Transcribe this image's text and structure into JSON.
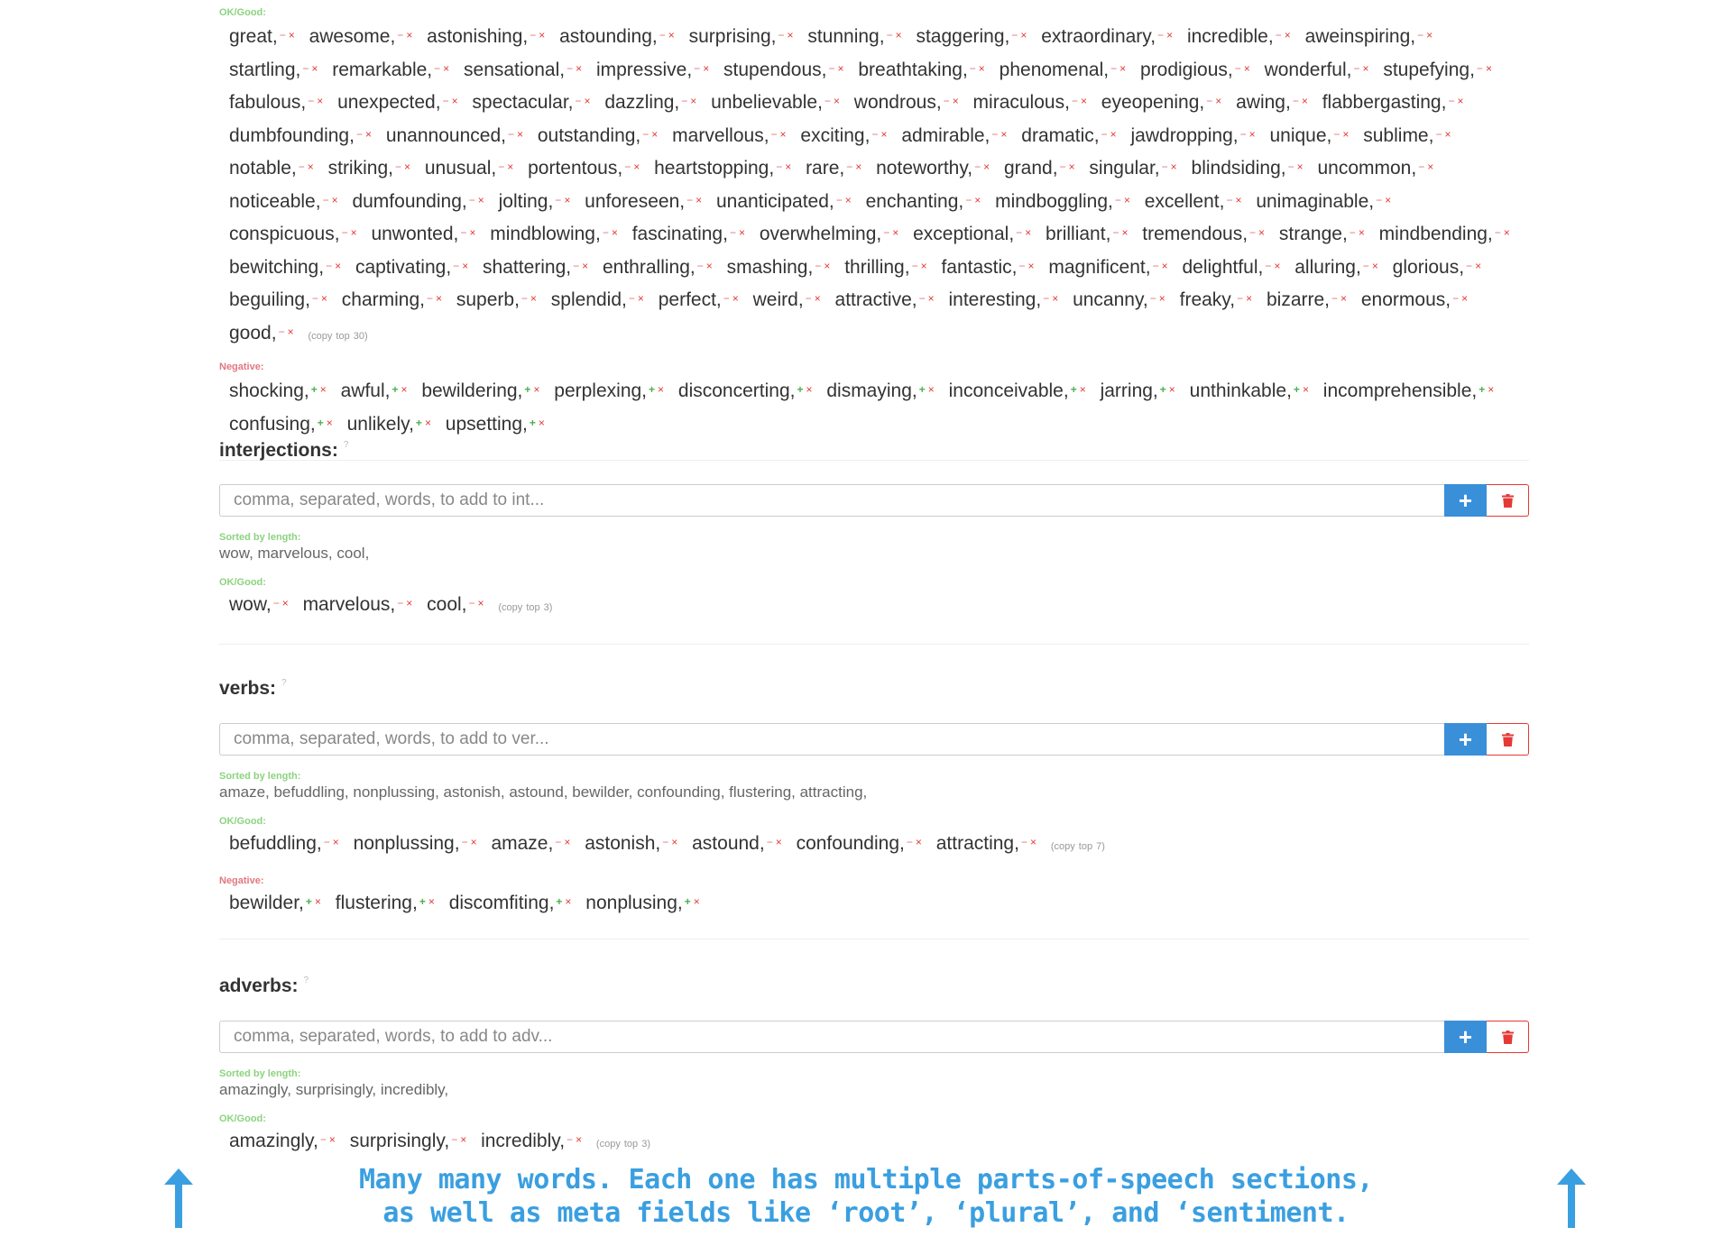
{
  "adjectives": {
    "good_label": "OK/Good:",
    "good_words": [
      "great,",
      "awesome,",
      "astonishing,",
      "astounding,",
      "surprising,",
      "stunning,",
      "staggering,",
      "extraordinary,",
      "incredible,",
      "aweinspiring,",
      "startling,",
      "remarkable,",
      "sensational,",
      "impressive,",
      "stupendous,",
      "breathtaking,",
      "phenomenal,",
      "prodigious,",
      "wonderful,",
      "stupefying,",
      "fabulous,",
      "unexpected,",
      "spectacular,",
      "dazzling,",
      "unbelievable,",
      "wondrous,",
      "miraculous,",
      "eyeopening,",
      "awing,",
      "flabbergasting,",
      "dumbfounding,",
      "unannounced,",
      "outstanding,",
      "marvellous,",
      "exciting,",
      "admirable,",
      "dramatic,",
      "jawdropping,",
      "unique,",
      "sublime,",
      "notable,",
      "striking,",
      "unusual,",
      "portentous,",
      "heartstopping,",
      "rare,",
      "noteworthy,",
      "grand,",
      "singular,",
      "blindsiding,",
      "uncommon,",
      "noticeable,",
      "dumfounding,",
      "jolting,",
      "unforeseen,",
      "unanticipated,",
      "enchanting,",
      "mindboggling,",
      "excellent,",
      "unimaginable,",
      "conspicuous,",
      "unwonted,",
      "mindblowing,",
      "fascinating,",
      "overwhelming,",
      "exceptional,",
      "brilliant,",
      "tremendous,",
      "strange,",
      "mindbending,",
      "bewitching,",
      "captivating,",
      "shattering,",
      "enthralling,",
      "smashing,",
      "thrilling,",
      "fantastic,",
      "magnificent,",
      "delightful,",
      "alluring,",
      "glorious,",
      "beguiling,",
      "charming,",
      "superb,",
      "splendid,",
      "perfect,",
      "weird,",
      "attractive,",
      "interesting,",
      "uncanny,",
      "freaky,",
      "bizarre,",
      "enormous,",
      "good,"
    ],
    "copy_top": "(copy top 30)",
    "neg_label": "Negative:",
    "neg_words": [
      "shocking,",
      "awful,",
      "bewildering,",
      "perplexing,",
      "disconcerting,",
      "dismaying,",
      "inconceivable,",
      "jarring,",
      "unthinkable,",
      "incomprehensible,",
      "confusing,",
      "unlikely,",
      "upsetting,"
    ]
  },
  "interjections": {
    "title": "interjections:",
    "help": "?",
    "placeholder": "comma, separated, words, to add to int...",
    "sorted_label": "Sorted by length:",
    "sorted": "wow, marvelous, cool,",
    "good_label": "OK/Good:",
    "good_words": [
      "wow,",
      "marvelous,",
      "cool,"
    ],
    "copy_top": "(copy top 3)"
  },
  "verbs": {
    "title": "verbs:",
    "help": "?",
    "placeholder": "comma, separated, words, to add to ver...",
    "sorted_label": "Sorted by length:",
    "sorted": "amaze, befuddling, nonplussing, astonish, astound, bewilder, confounding, flustering, attracting,",
    "good_label": "OK/Good:",
    "good_words": [
      "befuddling,",
      "nonplussing,",
      "amaze,",
      "astonish,",
      "astound,",
      "confounding,",
      "attracting,"
    ],
    "copy_top": "(copy top 7)",
    "neg_label": "Negative:",
    "neg_words": [
      "bewilder,",
      "flustering,",
      "discomfiting,",
      "nonplusing,"
    ]
  },
  "adverbs": {
    "title": "adverbs:",
    "help": "?",
    "placeholder": "comma, separated, words, to add to adv...",
    "sorted_label": "Sorted by length:",
    "sorted": "amazingly, surprisingly, incredibly,",
    "good_label": "OK/Good:",
    "good_words": [
      "amazingly,",
      "surprisingly,",
      "incredibly,"
    ],
    "copy_top": "(copy top 3)"
  },
  "controls": {
    "minus": "−",
    "plus": "+",
    "remove": "×",
    "add_button": "+"
  },
  "caption": {
    "line1": "Many many words. Each one has multiple parts-of-speech sections,",
    "line2": "as well as meta fields like ‘root’, ‘plural’, and ‘sentiment.",
    "accent_color": "#3a9fe0"
  },
  "icons": {
    "trash": "trash-icon",
    "arrow": "up-arrow-icon"
  }
}
